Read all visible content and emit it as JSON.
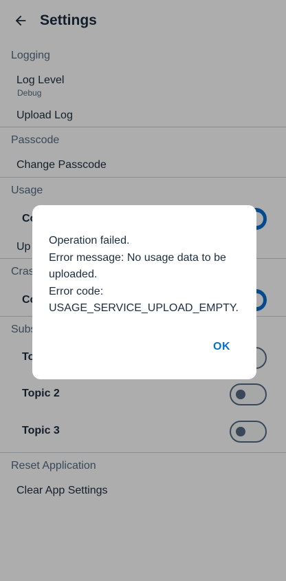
{
  "app_bar": {
    "title": "Settings",
    "back_icon": "arrow-left-icon"
  },
  "sections": {
    "logging": {
      "header": "Logging",
      "log_level_title": "Log Level",
      "log_level_value": "Debug",
      "upload_log": "Upload Log"
    },
    "passcode": {
      "header": "Passcode",
      "change_passcode": "Change Passcode"
    },
    "usage": {
      "header": "Usage",
      "consent_partial": "Co",
      "upload_partial": "Up"
    },
    "crash": {
      "header_partial": "Cras",
      "consent_partial": "Co"
    },
    "subscriptions": {
      "header_partial": "Subs",
      "topic1_partial": "To",
      "topic2": "Topic 2",
      "topic3": "Topic 3"
    },
    "reset": {
      "header": "Reset Application",
      "clear_settings": "Clear App Settings"
    }
  },
  "toggles": {
    "usage_consent": true,
    "crash_consent": true,
    "topic1": false,
    "topic2": false,
    "topic3": false
  },
  "dialog": {
    "message": "Operation failed.\nError message: No usage data to be uploaded.\nError code: USAGE_SERVICE_UPLOAD_EMPTY.",
    "ok_label": "OK"
  },
  "colors": {
    "accent": "#0a6ed1",
    "text_primary": "#1d2d3e",
    "text_secondary": "#556b82",
    "divider": "#c8cfd6",
    "scrim": "rgba(0,0,0,0.32)"
  }
}
